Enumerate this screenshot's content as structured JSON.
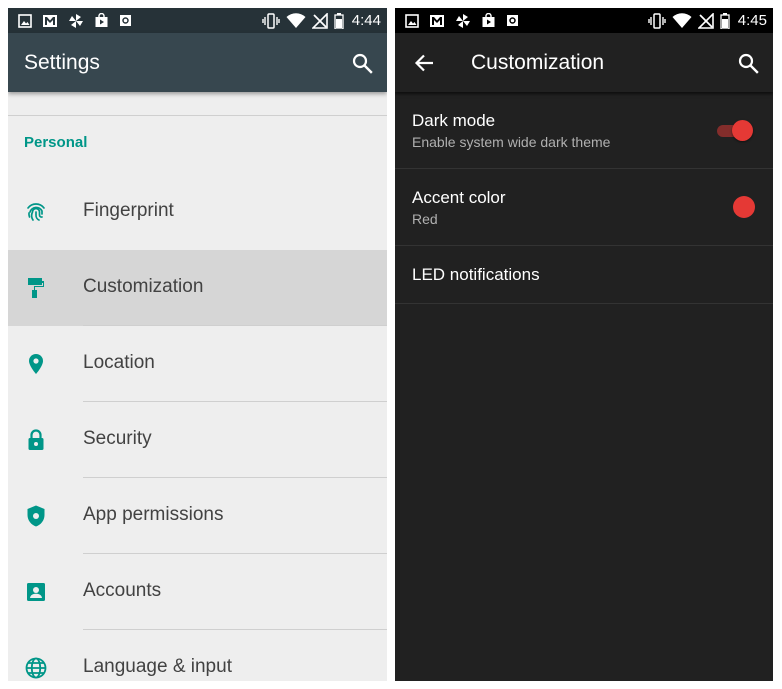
{
  "colors": {
    "teal_accent": "#009688",
    "accent_red": "#e53935",
    "left_appbar": "#37474f",
    "left_statusbar": "#263238",
    "dark_background": "#212121"
  },
  "left_screen": {
    "status_bar": {
      "time": "4:44",
      "notification_icons": [
        "image-icon",
        "gmail-icon",
        "pinwheel-icon",
        "shopping-bag-icon",
        "square-app-icon"
      ],
      "status_icons": [
        "vibrate-icon",
        "wifi-icon",
        "no-signal-icon",
        "battery-icon"
      ]
    },
    "app_bar": {
      "title": "Settings",
      "action_icon": "search-icon"
    },
    "section_header": "Personal",
    "items": [
      {
        "label": "Fingerprint",
        "icon": "fingerprint-icon",
        "active": false
      },
      {
        "label": "Customization",
        "icon": "paint-roller-icon",
        "active": true
      },
      {
        "label": "Location",
        "icon": "location-pin-icon",
        "active": false
      },
      {
        "label": "Security",
        "icon": "lock-icon",
        "active": false
      },
      {
        "label": "App permissions",
        "icon": "shield-icon",
        "active": false
      },
      {
        "label": "Accounts",
        "icon": "account-box-icon",
        "active": false
      },
      {
        "label": "Language & input",
        "icon": "globe-icon",
        "active": false
      }
    ]
  },
  "right_screen": {
    "status_bar": {
      "time": "4:45",
      "notification_icons": [
        "image-icon",
        "gmail-icon",
        "pinwheel-icon",
        "shopping-bag-icon",
        "square-app-icon"
      ],
      "status_icons": [
        "vibrate-icon",
        "wifi-icon",
        "no-signal-icon",
        "battery-icon"
      ]
    },
    "app_bar": {
      "title": "Customization",
      "nav_icon": "back-arrow-icon",
      "action_icon": "search-icon"
    },
    "prefs": {
      "dark_mode": {
        "title": "Dark mode",
        "summary": "Enable system wide dark theme",
        "enabled": true
      },
      "accent_color": {
        "title": "Accent color",
        "summary": "Red",
        "color": "#e53935"
      },
      "led_notifications": {
        "title": "LED notifications"
      }
    }
  }
}
